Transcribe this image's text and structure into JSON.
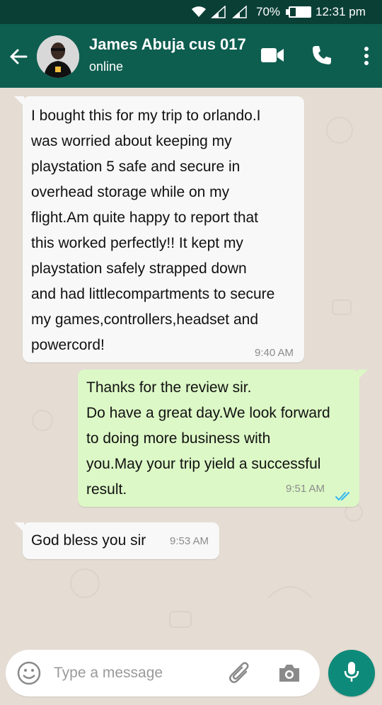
{
  "status_bar": {
    "battery": "70%",
    "time": "12:31 pm",
    "icons": [
      "wifi-icon",
      "signal-icon",
      "signal-icon",
      "battery-icon"
    ]
  },
  "header": {
    "contact_name": "James Abuja cus 017",
    "status": "online",
    "icons": [
      "back-arrow-icon",
      "avatar",
      "video-call-icon",
      "phone-icon",
      "more-options-icon"
    ]
  },
  "messages": [
    {
      "direction": "incoming",
      "text": "I bought this for my trip to orlando.I\nwas worried about keeping my\nplaystation 5 safe and secure in\noverhead storage while on my\nflight.Am quite happy to report that\nthis worked perfectly!! It kept my\nplaystation safely strapped down\nand had littlecompartments to secure\nmy games,controllers,headset and\npowercord!",
      "time": "9:40 AM"
    },
    {
      "direction": "outgoing",
      "text": "Thanks for the review sir.\nDo have a great day.We look forward\nto doing more business with\nyou.May your trip yield a successful\nresult.",
      "time": "9:51 AM",
      "read_status": "read"
    },
    {
      "direction": "incoming",
      "text": "God bless you sir",
      "time": "9:53 AM"
    }
  ],
  "composer": {
    "placeholder": "Type a message",
    "icons": [
      "emoji-icon",
      "attach-icon",
      "camera-icon",
      "mic-icon"
    ]
  },
  "colors": {
    "status_bar": "#0a3f36",
    "header": "#0e5e50",
    "chat_background": "#e5ddd4",
    "incoming_bubble": "#f8f8f8",
    "outgoing_bubble": "#dcf8c6",
    "mic_button": "#0e8a7a",
    "read_ticks": "#34b7f1"
  }
}
